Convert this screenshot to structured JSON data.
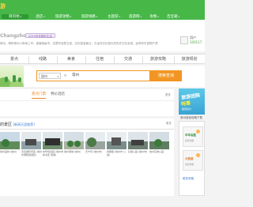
{
  "site": {
    "logo": "游"
  },
  "nav": {
    "items": [
      {
        "label": "目的地",
        "active": true
      },
      {
        "label": "酒店"
      },
      {
        "label": "旅游攻略"
      },
      {
        "label": "旅游线路"
      },
      {
        "label": "主题游"
      },
      {
        "label": "旅游网"
      },
      {
        "label": "攻略"
      },
      {
        "label": "百宝箱"
      }
    ]
  },
  "header": {
    "city": "Changzhou",
    "badge": "2019全年精彩生活",
    "description": "常州，简称常州人和地上市，省辖地级市，这里有名胜古迹，文化旅游景点，古运河文化悠久的历史文化名城，民风有丰富物产资源，风土人情 ...",
    "user": {
      "name": "用户",
      "count": "100117"
    }
  },
  "categories": [
    "景点",
    "线路",
    "美食",
    "住宿",
    "交通",
    "旅游攻略",
    "旅游规划"
  ],
  "search": {
    "select_value": "国内",
    "input_value": "常州",
    "button_label": "搜索查询"
  },
  "tabs": [
    {
      "label": "景点门票",
      "active": true
    },
    {
      "label": "特价酒店",
      "active": false
    }
  ],
  "more_label": "更多",
  "right_ad": {
    "line1": "旅游团购",
    "line2": "特惠",
    "line3": "超值好价",
    "caption": "常州旅游攻略下载",
    "box1_label": "中华名胜",
    "box1_sub": "旅游攻略",
    "box2_label": "大旅游",
    "box2_sub": "旅游攻略",
    "link": "更多攻略"
  },
  "spots": {
    "title": "的景区",
    "subtitle": "[新闻天涯推荐]",
    "more": "更多",
    "items": [
      {
        "caption": "常州园林 (常州)"
      },
      {
        "caption": "天目湖风景区 (常州市溧阳旅游区)"
      },
      {
        "caption": "中华恐龙园 (常州市新北区 旅游)"
      },
      {
        "caption": "常州淹城 (常州)"
      },
      {
        "caption": "天宁寺 (常州市)"
      },
      {
        "caption": "青果巷 (常州市 公园)"
      },
      {
        "caption": "红梅公园 (常州市)"
      },
      {
        "caption": "常州东坡公园"
      }
    ]
  },
  "colors": {
    "nav_green": "#47b748",
    "accent_orange": "#f29623",
    "link_blue": "#3a7bd5"
  }
}
